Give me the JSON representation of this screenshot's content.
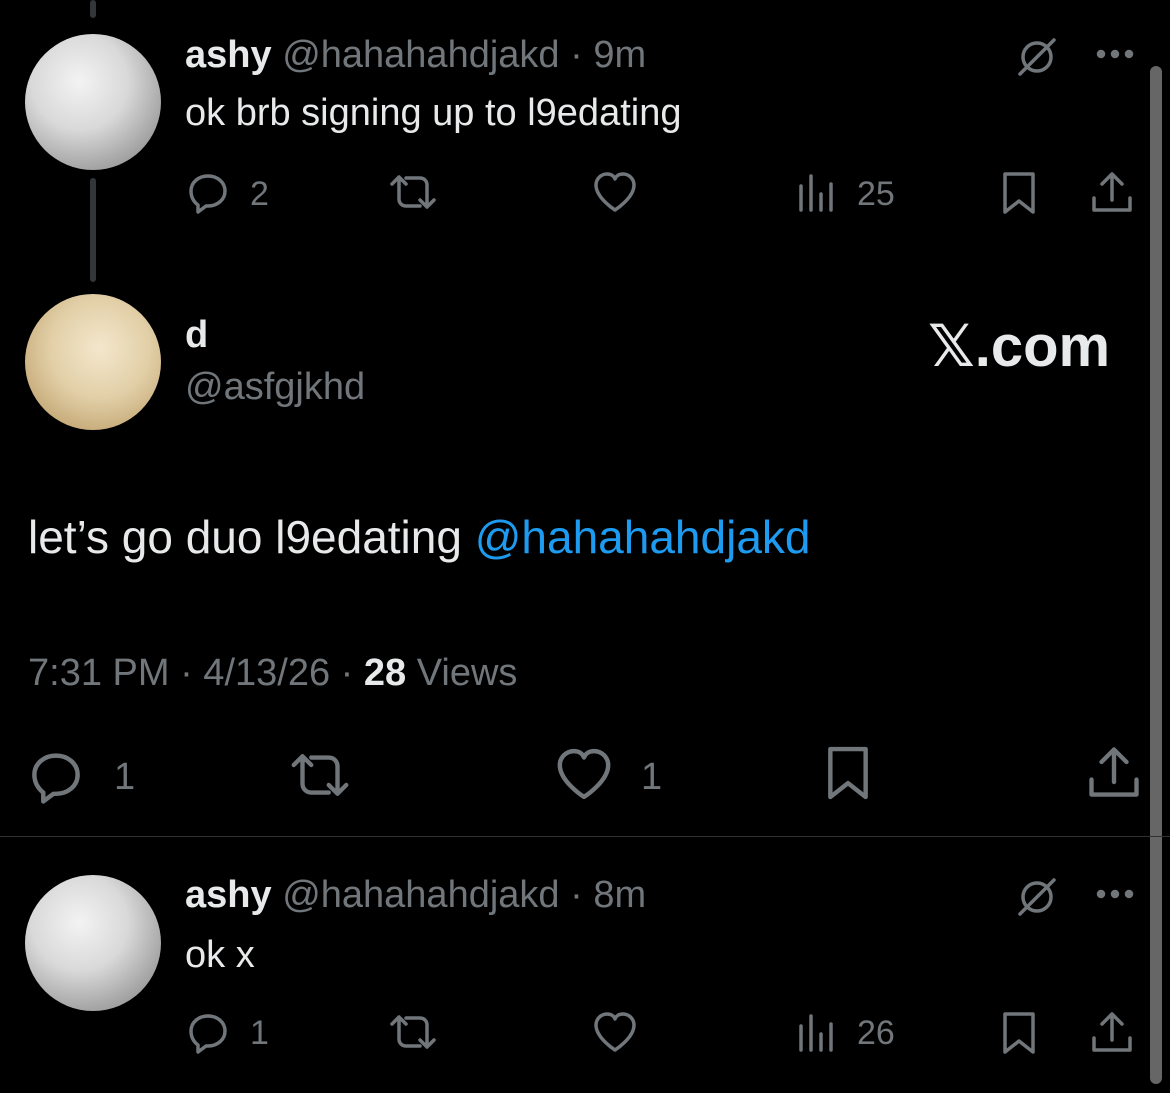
{
  "reply_top": {
    "name": "ashy",
    "handle": "@hahahahdjakd",
    "time": "· 9m",
    "text": "ok brb signing up to l9edating",
    "reply_count": "2",
    "views": "25"
  },
  "main_post": {
    "name": "d",
    "handle": "@asfgjkhd",
    "brand": "𝕏.com",
    "text_prefix": "let’s go duo l9edating ",
    "mention": "@hahahahdjakd",
    "time": "7:31 PM",
    "date": "· 4/13/26 ·",
    "views_count": "28",
    "views_label": "Views",
    "reply_count": "1",
    "like_count": "1"
  },
  "reply_bottom": {
    "name": "ashy",
    "handle": "@hahahahdjakd",
    "time": "· 8m",
    "text": "ok x",
    "reply_count": "1",
    "views": "26"
  },
  "colors": {
    "background": "#000000",
    "text": "#e7e9ea",
    "muted": "#71767b",
    "link": "#1d9bf0"
  },
  "icons": [
    "reply-icon",
    "retweet-icon",
    "like-icon",
    "views-icon",
    "bookmark-icon",
    "share-icon",
    "grok-icon",
    "more-icon"
  ]
}
